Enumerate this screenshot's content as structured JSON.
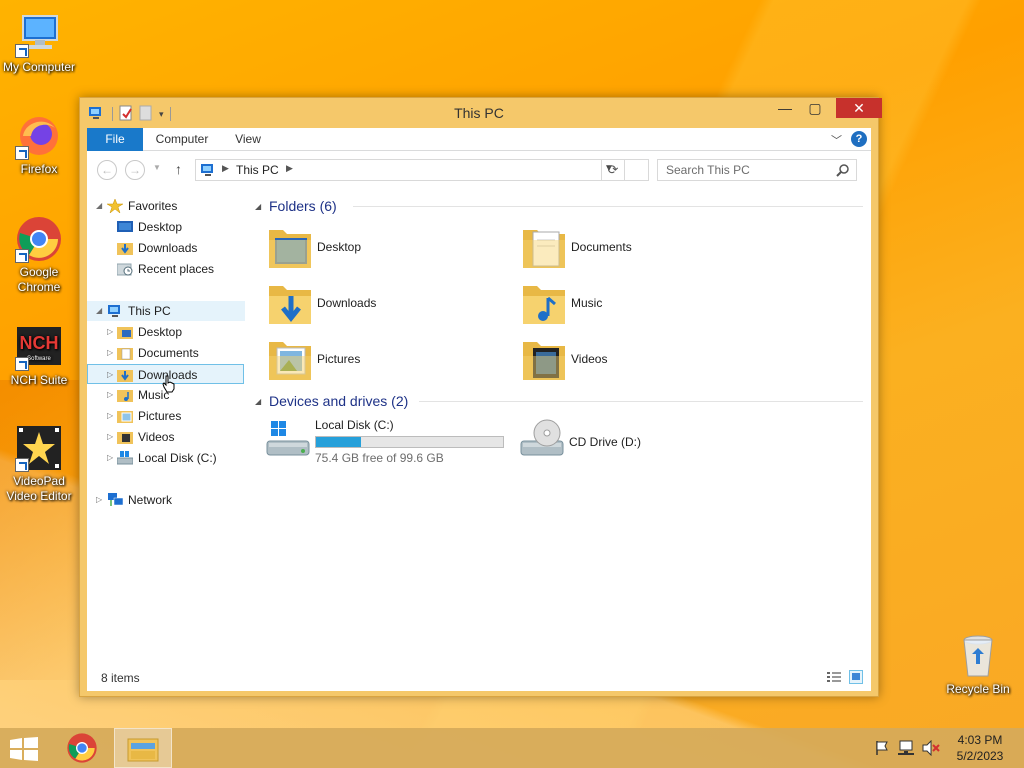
{
  "desktop": {
    "icons": [
      {
        "label": "My Computer",
        "icon": "computer-icon"
      },
      {
        "label": "Firefox",
        "icon": "firefox-icon"
      },
      {
        "label": "Google Chrome",
        "icon": "chrome-icon"
      },
      {
        "label": "NCH Suite",
        "icon": "nch-icon"
      },
      {
        "label": "VideoPad Video Editor",
        "icon": "videopad-icon"
      },
      {
        "label": "Recycle Bin",
        "icon": "recycle-bin-icon"
      }
    ],
    "nch_badge": "Software"
  },
  "window": {
    "title": "This PC",
    "controls": {
      "minimize": "—",
      "maximize": "▢",
      "close": "✕"
    },
    "ribbon": {
      "tabs": [
        "File",
        "Computer",
        "View"
      ],
      "help": "?"
    },
    "address": {
      "path": "This PC",
      "search_placeholder": "Search This PC"
    },
    "nav_pane": {
      "favorites": {
        "label": "Favorites",
        "items": [
          "Desktop",
          "Downloads",
          "Recent places"
        ]
      },
      "this_pc": {
        "label": "This PC",
        "items": [
          "Desktop",
          "Documents",
          "Downloads",
          "Music",
          "Pictures",
          "Videos",
          "Local Disk (C:)"
        ]
      },
      "network": {
        "label": "Network"
      },
      "selected": "Downloads"
    },
    "content": {
      "folders_header": "Folders (6)",
      "folders": [
        "Desktop",
        "Documents",
        "Downloads",
        "Music",
        "Pictures",
        "Videos"
      ],
      "devices_header": "Devices and drives (2)",
      "drives": [
        {
          "name": "Local Disk (C:)",
          "free_text": "75.4 GB free of 99.6 GB",
          "used_fraction": 0.243
        },
        {
          "name": "CD Drive (D:)"
        }
      ]
    },
    "status": {
      "item_count": "8 items"
    }
  },
  "taskbar": {
    "clock_time": "4:03 PM",
    "clock_date": "5/2/2023"
  },
  "colors": {
    "accent": "#1979ca",
    "close": "#c7312c",
    "section_header": "#1e3287",
    "drive_fill": "#26a0da",
    "selection": "#e5f3fb"
  }
}
